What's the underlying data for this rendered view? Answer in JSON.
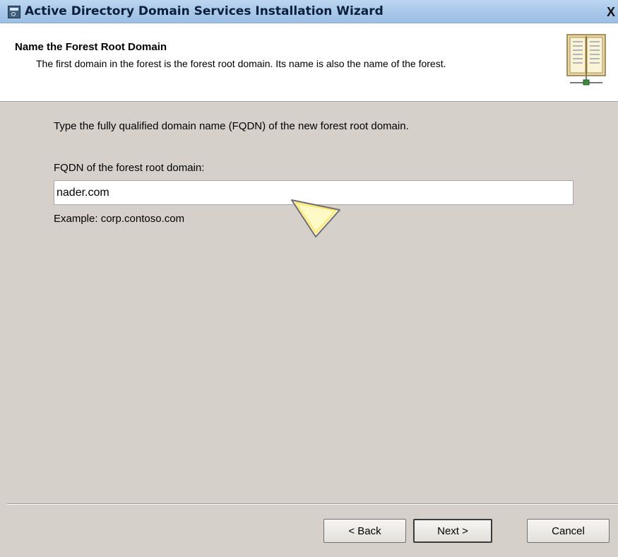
{
  "window": {
    "title": "Active Directory Domain Services Installation Wizard",
    "close_label": "X"
  },
  "header": {
    "title": "Name the Forest Root Domain",
    "description": "The first domain in the forest is the forest root domain. Its name is also the name of the forest."
  },
  "main": {
    "instruction": "Type the fully qualified domain name (FQDN) of the new forest root domain.",
    "fqdn_label": "FQDN of the forest root domain:",
    "fqdn_value": "nader.com",
    "example": "Example: corp.contoso.com"
  },
  "buttons": {
    "back": "< Back",
    "next": "Next >",
    "cancel": "Cancel"
  },
  "icons": {
    "window_icon": "wizard-app-icon",
    "header_icon": "book-icon",
    "pointer": "callout-pointer"
  }
}
